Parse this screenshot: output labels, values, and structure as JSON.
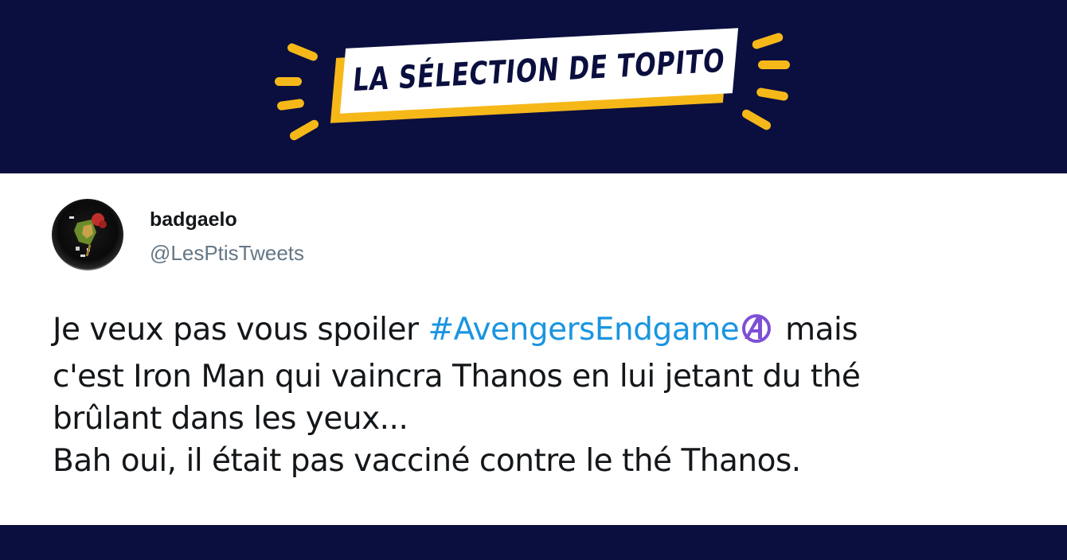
{
  "header": {
    "banner_text": "LA SÉLECTION DE TOPITO"
  },
  "tweet": {
    "display_name": "badgaelo",
    "handle": "@LesPtisTweets",
    "line1_before": "Je veux pas vous spoiler ",
    "hashtag": "#AvengersEndgame",
    "line1_after": " mais",
    "line2": "c'est Iron Man qui vaincra Thanos en lui jetant du thé",
    "line3": "brûlant dans les yeux...",
    "line4": "Bah oui, il était pas vacciné contre le thé Thanos."
  },
  "colors": {
    "navy": "#0b0f3f",
    "yellow": "#f6b819",
    "hashtag_blue": "#1b95e0",
    "avengers_purple": "#7d4fd6"
  },
  "icons": {
    "hashflag": "avengers-a-icon",
    "avatar": "profile-avatar"
  }
}
